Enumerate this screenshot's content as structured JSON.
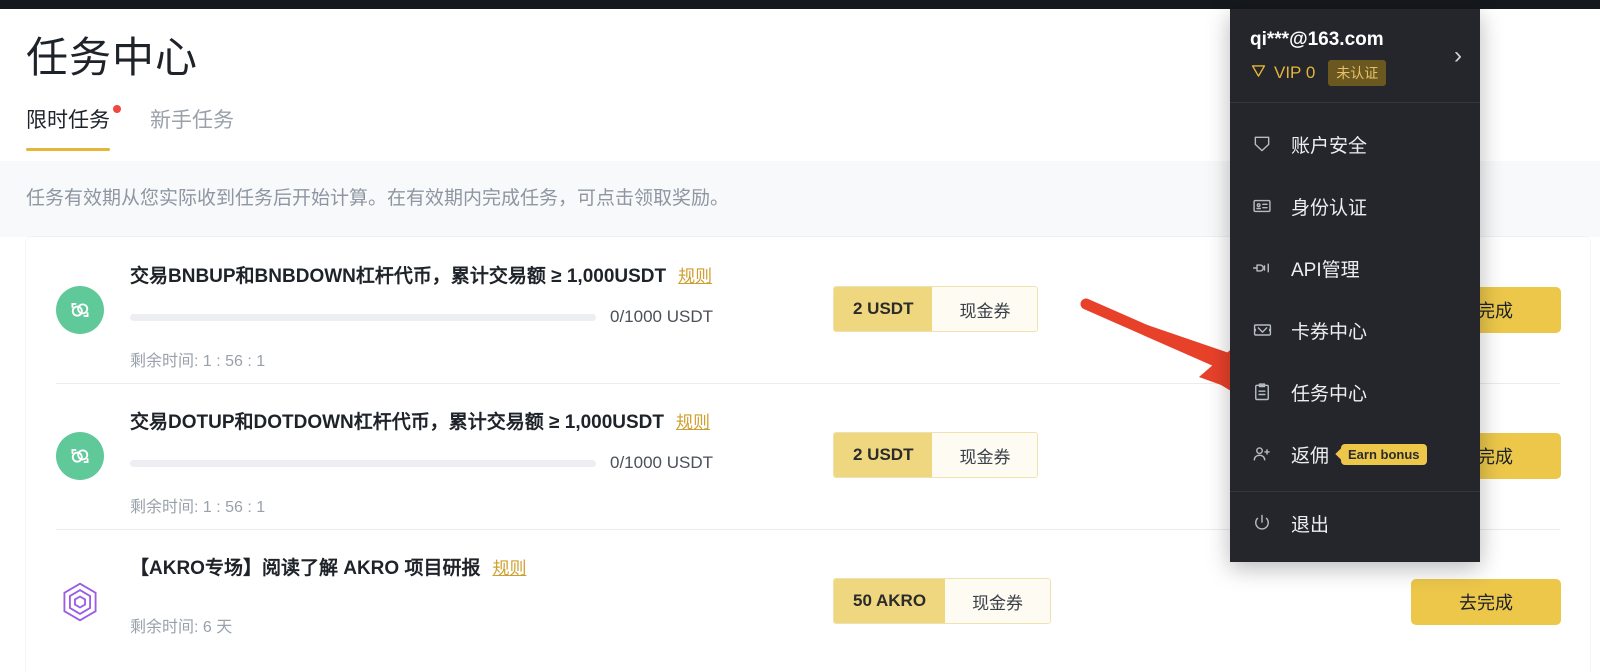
{
  "page": {
    "title": "任务中心",
    "tabs": [
      {
        "label": "限时任务",
        "active": true,
        "dot": true
      },
      {
        "label": "新手任务",
        "active": false,
        "dot": false
      }
    ],
    "notice": "任务有效期从您实际收到任务后开始计算。在有效期内完成任务，可点击领取奖励。"
  },
  "tasks": [
    {
      "icon": "leveraged-token-icon",
      "icon_style": "green",
      "title": "交易BNBUP和BNBDOWN杠杆代币，累计交易额 ≥ 1,000USDT",
      "rule_label": "规则",
      "progress_label": "0/1000 USDT",
      "progress_percent": 0,
      "time_label": "剩余时间: 1 : 56 : 1",
      "reward_amount": "2 USDT",
      "reward_kind": "现金券",
      "action_label": "去完成"
    },
    {
      "icon": "leveraged-token-icon",
      "icon_style": "green",
      "title": "交易DOTUP和DOTDOWN杠杆代币，累计交易额 ≥ 1,000USDT",
      "rule_label": "规则",
      "progress_label": "0/1000 USDT",
      "progress_percent": 0,
      "time_label": "剩余时间: 1 : 56 : 1",
      "reward_amount": "2 USDT",
      "reward_kind": "现金券",
      "action_label": "去完成"
    },
    {
      "icon": "akro-hexagon-icon",
      "icon_style": "plain",
      "title": "【AKRO专场】阅读了解 AKRO 项目研报",
      "rule_label": "规则",
      "progress_label": "",
      "progress_percent": 0,
      "time_label": "剩余时间: 6 天",
      "reward_amount": "50 AKRO",
      "reward_kind": "现金券",
      "action_label": "去完成"
    }
  ],
  "account_menu": {
    "email": "qi***@163.com",
    "vip_level": "VIP 0",
    "verify_badge": "未认证",
    "items": [
      {
        "label": "账户安全",
        "icon": "shield-icon",
        "badge": ""
      },
      {
        "label": "身份认证",
        "icon": "id-card-icon",
        "badge": ""
      },
      {
        "label": "API管理",
        "icon": "api-plug-icon",
        "badge": ""
      },
      {
        "label": "卡券中心",
        "icon": "ticket-icon",
        "badge": ""
      },
      {
        "label": "任务中心",
        "icon": "clipboard-icon",
        "badge": ""
      },
      {
        "label": "返佣",
        "icon": "user-plus-icon",
        "badge": "Earn bonus"
      }
    ],
    "logout": {
      "label": "退出",
      "icon": "power-icon"
    }
  },
  "annotation": {
    "arrow_color": "#e8412a"
  },
  "colors": {
    "accent": "#ecc74a",
    "green_icon": "#5fc99a",
    "purple_icon": "#9b5de5",
    "menu_bg": "#24262b",
    "notice_bg": "#f8f9fa"
  }
}
